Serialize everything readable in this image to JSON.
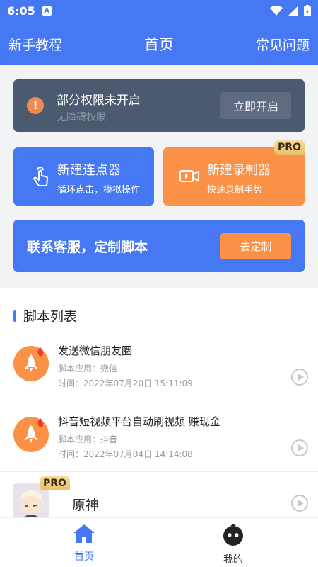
{
  "status_bar": {
    "time": "6:05",
    "app_badge": "A"
  },
  "nav": {
    "left": "新手教程",
    "title": "首页",
    "right": "常见问题"
  },
  "permission_banner": {
    "title": "部分权限未开启",
    "subtitle": "无障碍权限",
    "button": "立即开启",
    "icon": "warning-icon"
  },
  "cards": [
    {
      "title": "新建连点器",
      "subtitle": "循环点击，模拟操作",
      "icon": "tap-finger-icon",
      "color": "#4578f2"
    },
    {
      "title": "新建录制器",
      "subtitle": "快速录制手势",
      "icon": "video-record-icon",
      "color": "#fb9146",
      "badge": "PRO"
    }
  ],
  "service_banner": {
    "title": "联系客服，定制脚本",
    "button": "去定制"
  },
  "script_list": {
    "title": "脚本列表",
    "items": [
      {
        "name": "发送微信朋友圈",
        "app": "脚本应用：微信",
        "time": "时间：2022年07月20日 15:11:09"
      },
      {
        "name": "抖音短视频平台自动刷视频 赚现金",
        "app": "脚本应用：抖音",
        "time": "时间：2022年07月04日 14:14:08"
      },
      {
        "name": "原神",
        "badge": "PRO"
      }
    ]
  },
  "tabs": [
    {
      "label": "首页",
      "icon": "home-icon",
      "active": true
    },
    {
      "label": "我的",
      "icon": "profile-icon",
      "active": false
    }
  ],
  "colors": {
    "primary": "#4578f2",
    "accent": "#fb9146",
    "banner_dark": "#4c5a70"
  }
}
